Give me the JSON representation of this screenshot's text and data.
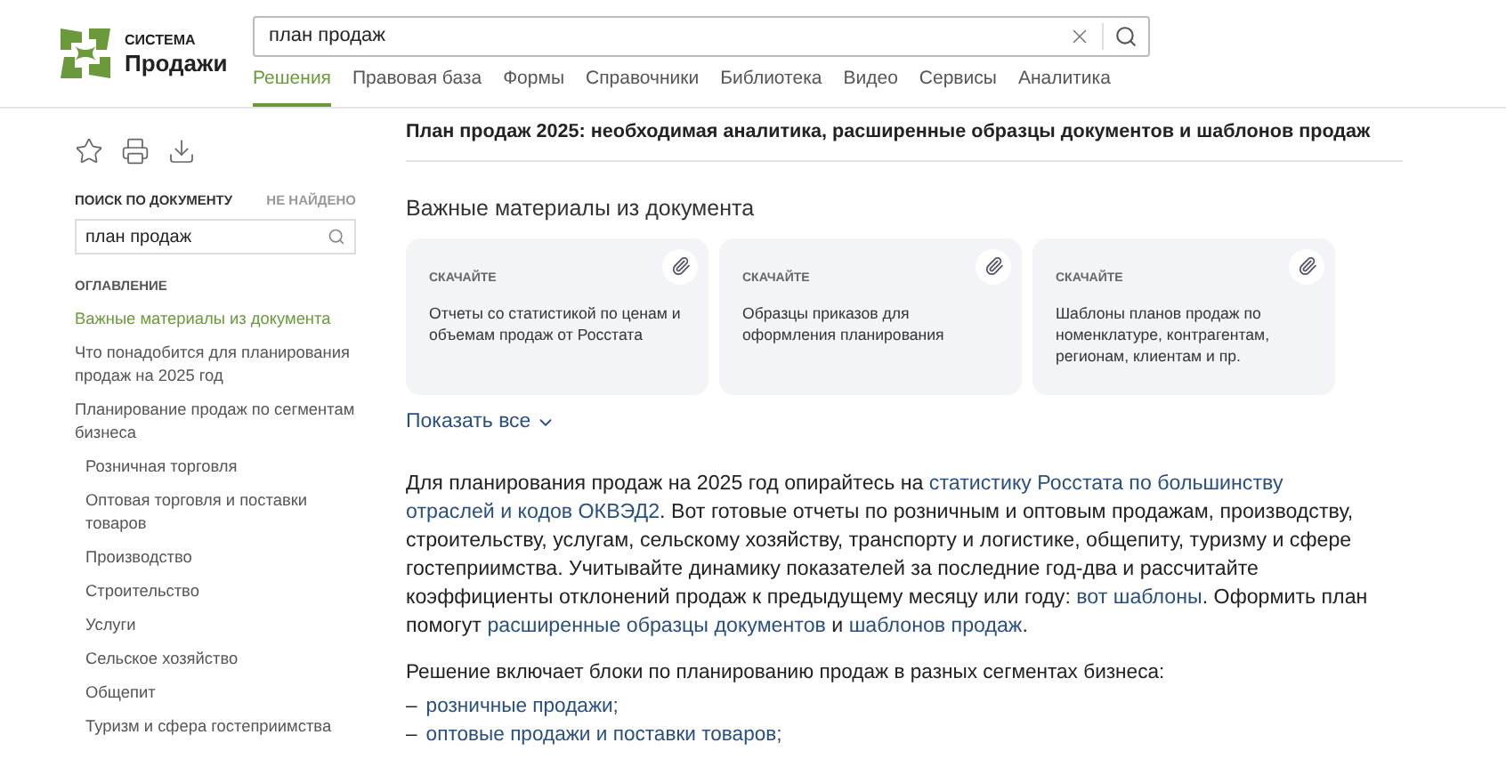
{
  "logo": {
    "small": "СИСТЕМА",
    "big": "Продажи"
  },
  "search": {
    "value": "план продаж"
  },
  "nav": [
    {
      "label": "Решения",
      "selected": true
    },
    {
      "label": "Правовая база",
      "selected": false
    },
    {
      "label": "Формы",
      "selected": false
    },
    {
      "label": "Справочники",
      "selected": false
    },
    {
      "label": "Библиотека",
      "selected": false
    },
    {
      "label": "Видео",
      "selected": false
    },
    {
      "label": "Сервисы",
      "selected": false
    },
    {
      "label": "Аналитика",
      "selected": false
    }
  ],
  "sidebar": {
    "doc_search_label": "ПОИСК ПО ДОКУМЕНТУ",
    "doc_search_status": "НЕ НАЙДЕНО",
    "doc_search_value": "план продаж",
    "toc_title": "ОГЛАВЛЕНИЕ",
    "toc": [
      {
        "label": "Важные материалы из документа",
        "selected": true
      },
      {
        "label": "Что понадобится для планирования продаж на 2025 год",
        "selected": false
      },
      {
        "label": "Планирование продаж по сегментам бизнеса",
        "selected": false,
        "children": [
          {
            "label": "Розничная торговля",
            "selected": false
          },
          {
            "label": "Оптовая торговля и поставки товаров",
            "selected": false
          },
          {
            "label": "Производство",
            "selected": false
          },
          {
            "label": "Строительство",
            "selected": false
          },
          {
            "label": "Услуги",
            "selected": false
          },
          {
            "label": "Сельское хозяйство",
            "selected": false
          },
          {
            "label": "Общепит",
            "selected": false
          },
          {
            "label": "Туризм и сфера гостеприимства",
            "selected": false
          }
        ]
      }
    ]
  },
  "article": {
    "title": "План продаж 2025: необходимая аналитика, расширенные образцы документов и шаблонов продаж",
    "materials_title": "Важные материалы из документа",
    "cards": [
      {
        "tag": "СКАЧАЙТЕ",
        "text": "Отчеты со статистикой по ценам и объемам продаж от Росстата"
      },
      {
        "tag": "СКАЧАЙТЕ",
        "text": "Образцы приказов для оформления планирования"
      },
      {
        "tag": "СКАЧАЙТЕ",
        "text": "Шаблоны планов продаж по номенклатуре, контрагентам, регионам, клиентам и пр."
      }
    ],
    "show_all": "Показать все",
    "paragraph": [
      {
        "kind": "text",
        "text": "Для планирования продаж на 2025 год опирайтесь на "
      },
      {
        "kind": "link",
        "text": "статистику Росстата по большинству"
      },
      {
        "kind": "link",
        "text": "отраслей и кодов ОКВЭД2"
      },
      {
        "kind": "text",
        "text": ". Вот готовые отчеты по розничным и оптовым продажам, производству, строительству, услугам, сельскому хозяйству, транспорту и логистике, общепиту, туризму и сфере гостеприимства. Учитывайте динамику показателей за последние год-два и рассчитайте коэффициенты отклонений продаж к предыдущему месяцу или году: "
      },
      {
        "kind": "link",
        "text": "вот шаблоны"
      },
      {
        "kind": "text",
        "text": ". Оформить план помогут "
      },
      {
        "kind": "link",
        "text": "расширенные образцы документов"
      },
      {
        "kind": "text",
        "text": " и "
      },
      {
        "kind": "link",
        "text": "шаблонов продаж"
      },
      {
        "kind": "text",
        "text": "."
      }
    ],
    "blocks_intro": "Решение включает блоки по планированию продаж в разных сегментах бизнеса:",
    "blocks": [
      {
        "marker": "–",
        "text": "розничные продажи;"
      },
      {
        "marker": "–",
        "text": "оптовые продажи и поставки товаров;"
      }
    ]
  }
}
